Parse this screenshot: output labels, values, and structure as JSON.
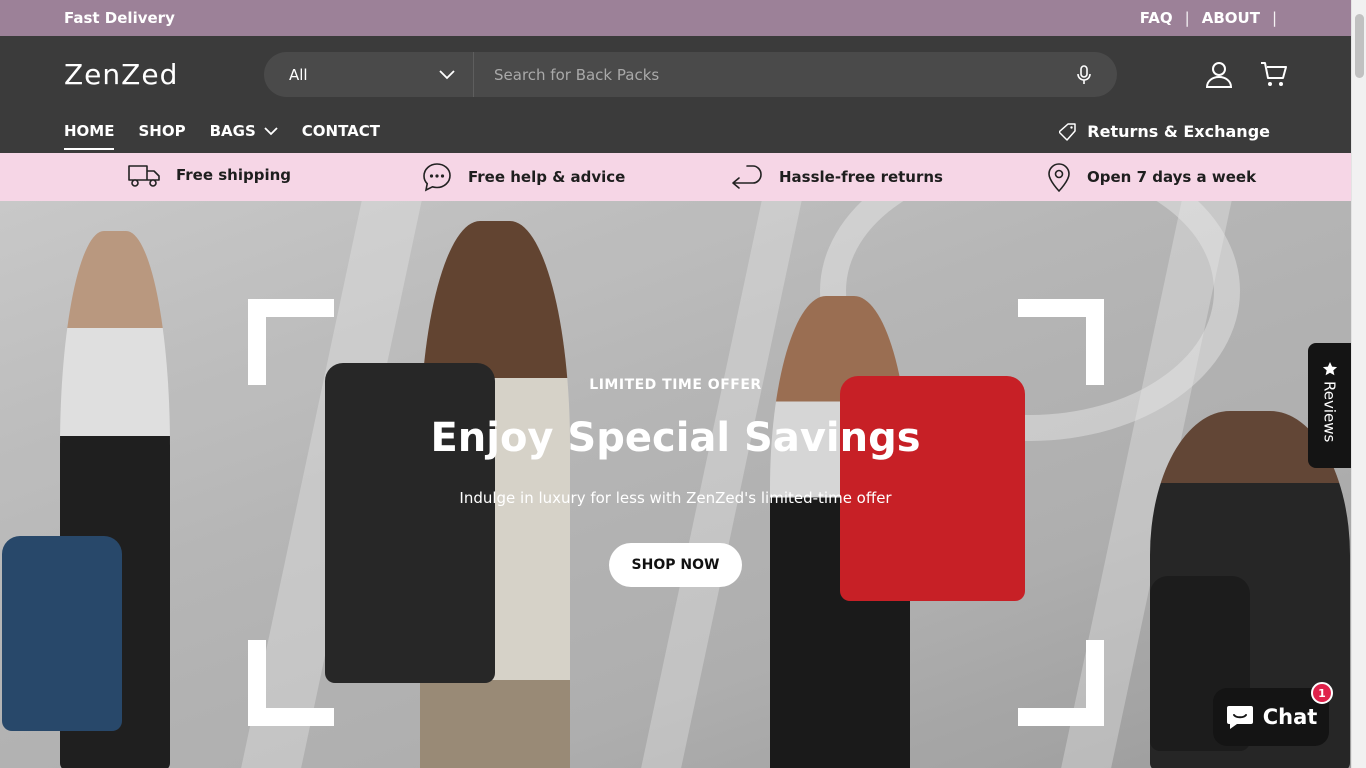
{
  "announcement": {
    "left_text": "Fast Delivery",
    "links": [
      "FAQ",
      "ABOUT"
    ],
    "separator": "|"
  },
  "header": {
    "logo": "ZenZed",
    "search": {
      "category": "All",
      "placeholder": "Search for Back Packs"
    },
    "icons": [
      "user-icon",
      "cart-icon",
      "microphone-icon",
      "chevron-down-icon"
    ],
    "nav": [
      {
        "label": "HOME",
        "active": true
      },
      {
        "label": "SHOP"
      },
      {
        "label": "BAGS",
        "dropdown": true
      },
      {
        "label": "CONTACT"
      }
    ],
    "returns_label": "Returns & Exchange"
  },
  "usp": [
    {
      "icon": "truck-icon",
      "label": "Free shipping"
    },
    {
      "icon": "chat-bubble-icon",
      "label": "Free help & advice"
    },
    {
      "icon": "return-arrow-icon",
      "label": "Hassle-free returns"
    },
    {
      "icon": "map-pin-icon",
      "label": "Open 7 days a week"
    }
  ],
  "hero": {
    "eyebrow": "LIMITED TIME OFFER",
    "headline": "Enjoy Special Savings",
    "subtext": "Indulge in luxury for less with ZenZed's limited-time offer",
    "cta": "SHOP NOW"
  },
  "widgets": {
    "reviews_label": "Reviews",
    "chat_label": "Chat",
    "chat_badge": "1"
  },
  "colors": {
    "announcement_bg": "#9c8198",
    "header_bg": "#3b3b3b",
    "usp_bg": "#f6d6e6",
    "bag_red": "#d8232a",
    "bag_blue": "#2c4f74",
    "bag_black": "#2b2b2b"
  }
}
